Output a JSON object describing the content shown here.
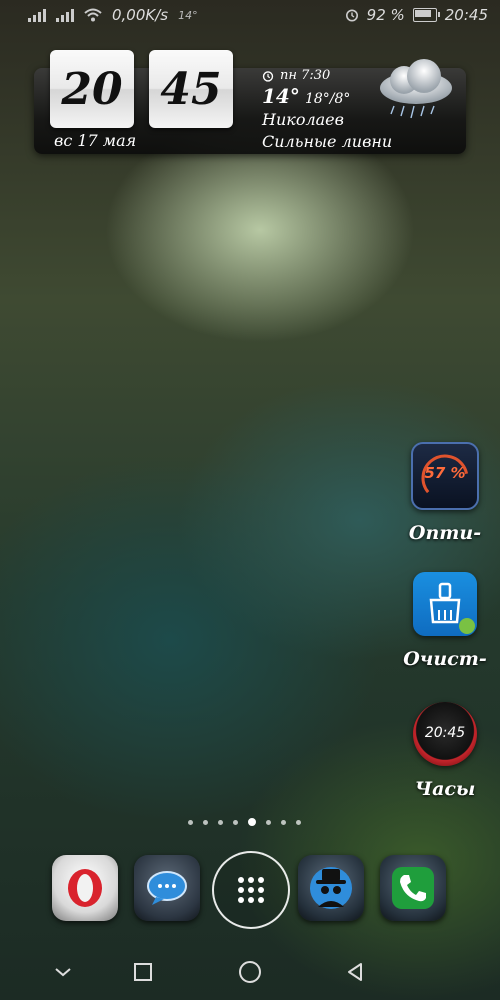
{
  "status_bar": {
    "net_speed": "0,00K/s",
    "small_temp": "14°",
    "battery_pct": "92 %",
    "time": "20:45"
  },
  "widget": {
    "hours": "20",
    "minutes": "45",
    "date": "вс 17 мая",
    "alarm": "пн 7:30",
    "temp_now": "14°",
    "temp_range": "18°/8°",
    "city": "Николаев",
    "condition": "Сильные ливни"
  },
  "apps": [
    {
      "icon_text": "57 %",
      "label": "Опти-"
    },
    {
      "label": "Очист-"
    },
    {
      "icon_text": "20:45",
      "label": "Часы"
    }
  ],
  "page_indicator": {
    "count": 8,
    "active_index": 4
  },
  "dock": [
    "opera-icon",
    "messages-icon",
    "app-drawer-icon",
    "incognito-icon",
    "phone-icon"
  ],
  "nav": [
    "hide-icon",
    "recents-icon",
    "home-icon",
    "back-icon"
  ],
  "colors": {
    "accent_red": "#c4252b",
    "cleaner_blue": "#1a8fe0",
    "phone_green": "#1f9e3c"
  }
}
